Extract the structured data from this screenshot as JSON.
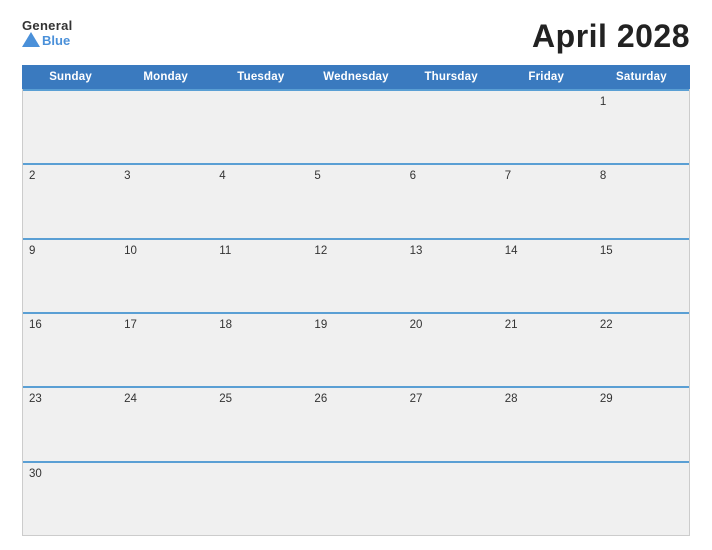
{
  "header": {
    "logo": {
      "general": "General",
      "blue": "Blue"
    },
    "title": "April 2028"
  },
  "calendar": {
    "days_of_week": [
      "Sunday",
      "Monday",
      "Tuesday",
      "Wednesday",
      "Thursday",
      "Friday",
      "Saturday"
    ],
    "weeks": [
      [
        {
          "day": "",
          "empty": true
        },
        {
          "day": "",
          "empty": true
        },
        {
          "day": "",
          "empty": true
        },
        {
          "day": "",
          "empty": true
        },
        {
          "day": "",
          "empty": true
        },
        {
          "day": "",
          "empty": true
        },
        {
          "day": "1",
          "empty": false
        }
      ],
      [
        {
          "day": "2",
          "empty": false
        },
        {
          "day": "3",
          "empty": false
        },
        {
          "day": "4",
          "empty": false
        },
        {
          "day": "5",
          "empty": false
        },
        {
          "day": "6",
          "empty": false
        },
        {
          "day": "7",
          "empty": false
        },
        {
          "day": "8",
          "empty": false
        }
      ],
      [
        {
          "day": "9",
          "empty": false
        },
        {
          "day": "10",
          "empty": false
        },
        {
          "day": "11",
          "empty": false
        },
        {
          "day": "12",
          "empty": false
        },
        {
          "day": "13",
          "empty": false
        },
        {
          "day": "14",
          "empty": false
        },
        {
          "day": "15",
          "empty": false
        }
      ],
      [
        {
          "day": "16",
          "empty": false
        },
        {
          "day": "17",
          "empty": false
        },
        {
          "day": "18",
          "empty": false
        },
        {
          "day": "19",
          "empty": false
        },
        {
          "day": "20",
          "empty": false
        },
        {
          "day": "21",
          "empty": false
        },
        {
          "day": "22",
          "empty": false
        }
      ],
      [
        {
          "day": "23",
          "empty": false
        },
        {
          "day": "24",
          "empty": false
        },
        {
          "day": "25",
          "empty": false
        },
        {
          "day": "26",
          "empty": false
        },
        {
          "day": "27",
          "empty": false
        },
        {
          "day": "28",
          "empty": false
        },
        {
          "day": "29",
          "empty": false
        }
      ],
      [
        {
          "day": "30",
          "empty": false
        },
        {
          "day": "",
          "empty": true
        },
        {
          "day": "",
          "empty": true
        },
        {
          "day": "",
          "empty": true
        },
        {
          "day": "",
          "empty": true
        },
        {
          "day": "",
          "empty": true
        },
        {
          "day": "",
          "empty": true
        }
      ]
    ]
  }
}
